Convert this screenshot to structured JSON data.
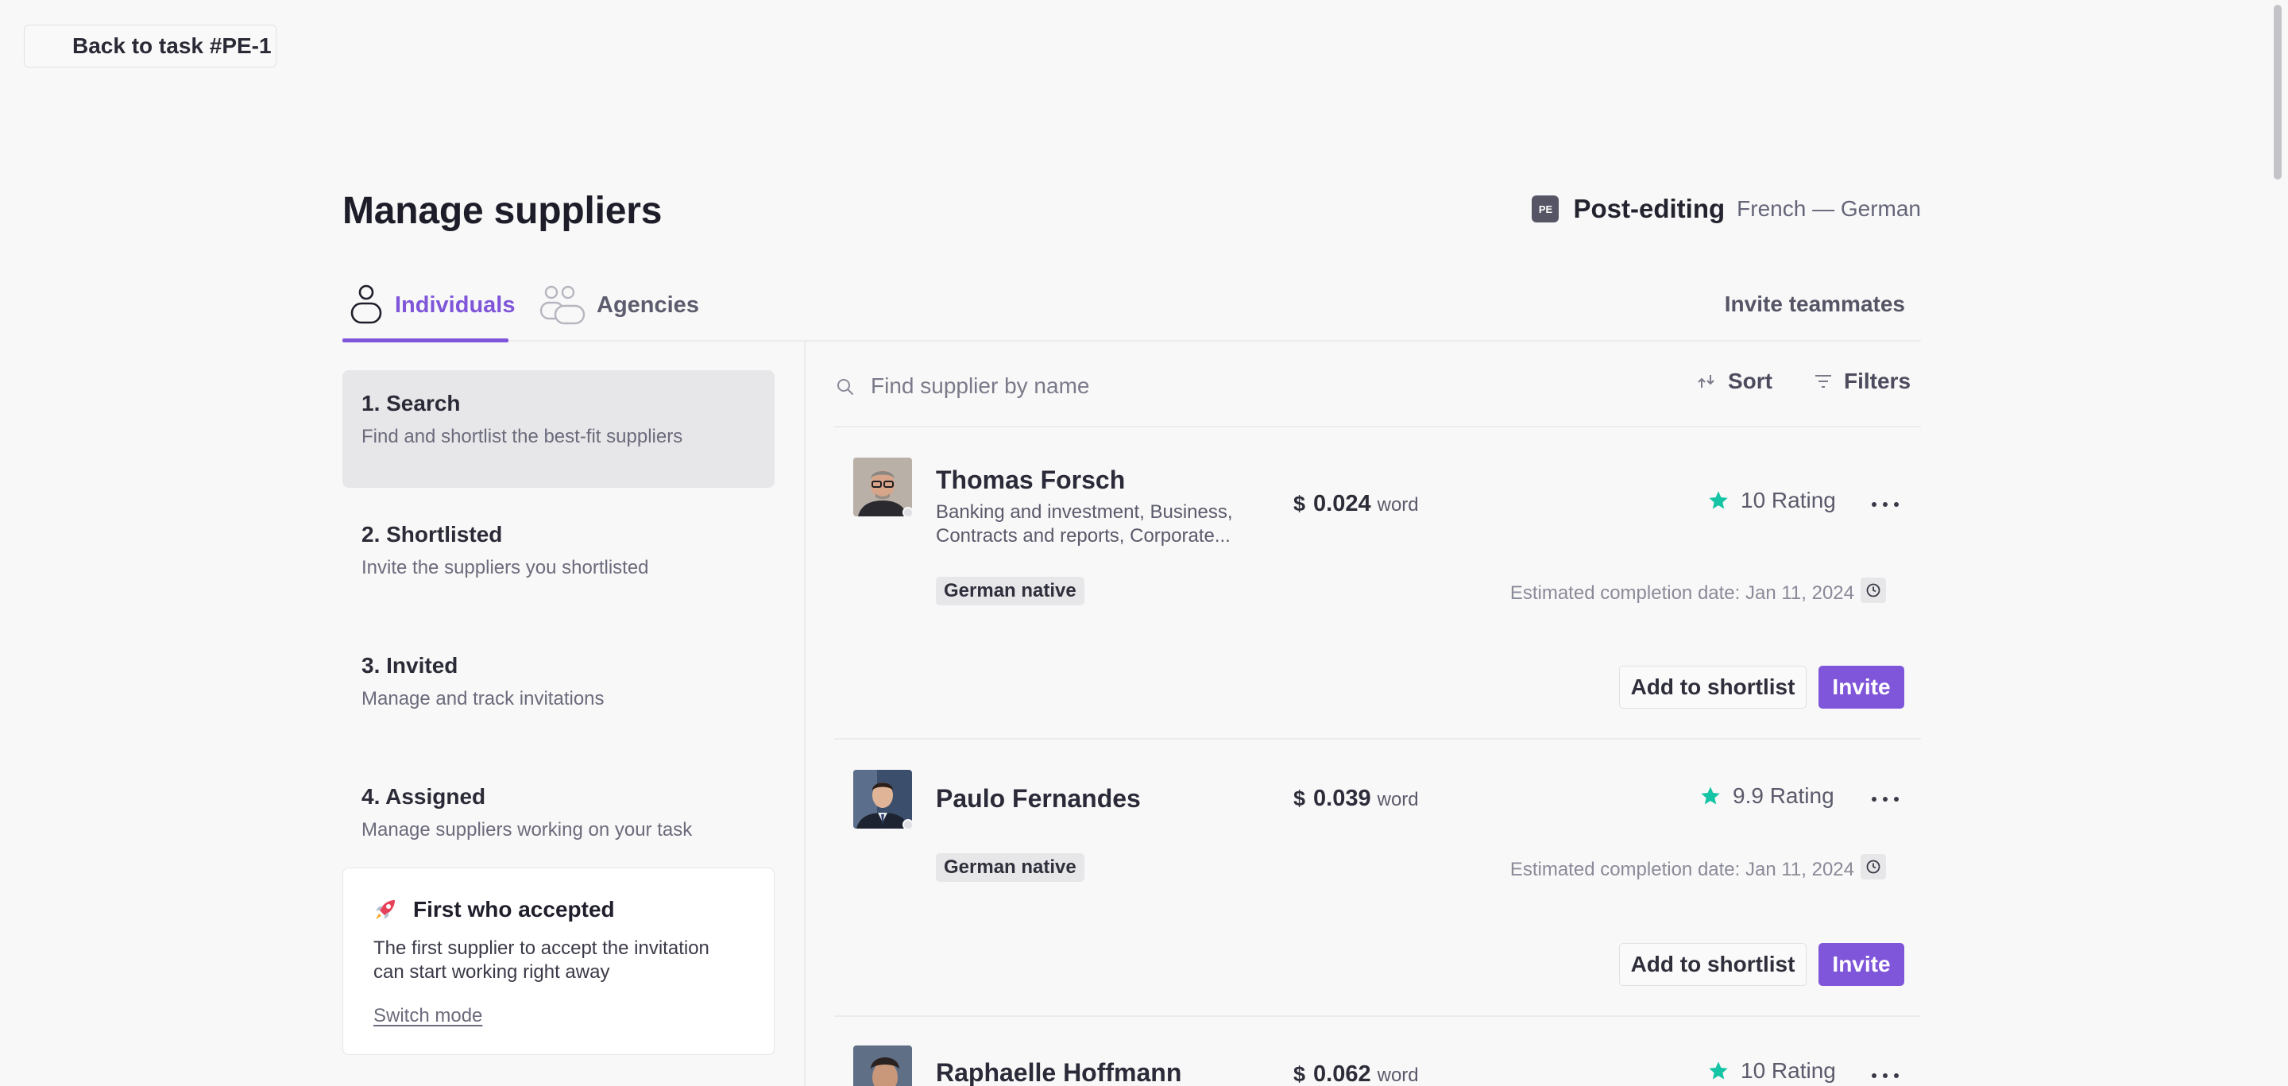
{
  "header": {
    "back_label": "Back to task #PE-1"
  },
  "page": {
    "title": "Manage suppliers"
  },
  "task": {
    "badge": "PE",
    "type": "Post-editing",
    "languages": "French — German"
  },
  "tabs": [
    {
      "label": "Individuals",
      "icon": "person-icon"
    },
    {
      "label": "Agencies",
      "icon": "group-icon"
    }
  ],
  "invite_teammates_label": "Invite teammates",
  "steps": [
    {
      "title": "1. Search",
      "desc": "Find and shortlist the best-fit suppliers"
    },
    {
      "title": "2. Shortlisted",
      "desc": "Invite the suppliers you shortlisted"
    },
    {
      "title": "3. Invited",
      "desc": "Manage and track invitations"
    },
    {
      "title": "4. Assigned",
      "desc": "Manage suppliers working on your task"
    }
  ],
  "mode_card": {
    "icon": "rocket-icon",
    "title": "First who accepted",
    "desc": "The first supplier to accept the invitation can start working right away",
    "switch_label": "Switch mode"
  },
  "search": {
    "placeholder": "Find supplier by name",
    "sort_label": "Sort",
    "filters_label": "Filters"
  },
  "suppliers": [
    {
      "name": "Thomas Forsch",
      "expertise": "Banking and investment, Business, Contracts and reports, Corporate...",
      "currency": "$",
      "price": "0.024",
      "unit": "word",
      "rating": "10 Rating",
      "native": "German native",
      "eta": "Estimated completion date: Jan 11, 2024",
      "shortlist_label": "Add to shortlist",
      "invite_label": "Invite"
    },
    {
      "name": "Paulo Fernandes",
      "currency": "$",
      "price": "0.039",
      "unit": "word",
      "rating": "9.9 Rating",
      "native": "German native",
      "eta": "Estimated completion date: Jan 11, 2024",
      "shortlist_label": "Add to shortlist",
      "invite_label": "Invite"
    },
    {
      "name": "Raphaelle Hoffmann",
      "currency": "$",
      "price": "0.062",
      "unit": "word",
      "rating": "10 Rating"
    }
  ],
  "colors": {
    "accent": "#7f56d9",
    "star": "#14c4a4",
    "background": "#f8f8f8"
  }
}
